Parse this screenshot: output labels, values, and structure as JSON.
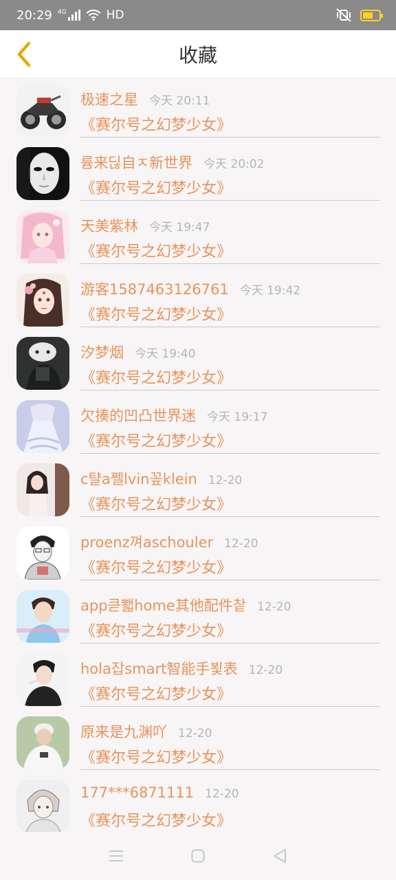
{
  "status_bar": {
    "time": "20:29",
    "network": "4G",
    "hd": "HD",
    "battery_level": 0.65
  },
  "header": {
    "title": "收藏"
  },
  "colors": {
    "accent": "#e8935a",
    "back_icon": "#f2c418",
    "muted": "#b5b5b5"
  },
  "favorites": [
    {
      "author": "极速之星",
      "time": "今天 20:11",
      "work": "《赛尔号之幻梦少女》",
      "avatar": "motorcycle"
    },
    {
      "author": "륨来딚自ㅈ新世界",
      "time": "今天 20:02",
      "work": "《赛尔号之幻梦少女》",
      "avatar": "mask"
    },
    {
      "author": "天美紫林",
      "time": "今天 19:47",
      "work": "《赛尔号之幻梦少女》",
      "avatar": "anime-pink"
    },
    {
      "author": "游客1587463126761",
      "time": "今天 19:42",
      "work": "《赛尔号之幻梦少女》",
      "avatar": "anime-girl"
    },
    {
      "author": "汐梦烟",
      "time": "今天 19:40",
      "work": "《赛尔号之幻梦少女》",
      "avatar": "dark-kitty"
    },
    {
      "author": "欠揍的凹凸世界迷",
      "time": "今天 19:17",
      "work": "《赛尔号之幻梦少女》",
      "avatar": "blue-dress"
    },
    {
      "author": "c턀a쩰lvin꽆klein",
      "time": "12-20",
      "work": "《赛尔号之幻梦少女》",
      "avatar": "girl-photo"
    },
    {
      "author": "proenz껴aschouler",
      "time": "12-20",
      "work": "《赛尔号之幻梦少女》",
      "avatar": "sketch-boy"
    },
    {
      "author": "app큳뾃home其他配件챁",
      "time": "12-20",
      "work": "《赛尔号之幻梦少女》",
      "avatar": "boy-blue"
    },
    {
      "author": "hola잡smart智能手뵟表",
      "time": "12-20",
      "work": "《赛尔号之幻梦少女》",
      "avatar": "boy-dark"
    },
    {
      "author": "原来是九渊吖",
      "time": "12-20",
      "work": "《赛尔号之幻梦少女》",
      "avatar": "boy-green"
    },
    {
      "author": "177***6871111",
      "time": "12-20",
      "work": "《赛尔号之幻梦少女》",
      "avatar": "sketch-face"
    }
  ]
}
